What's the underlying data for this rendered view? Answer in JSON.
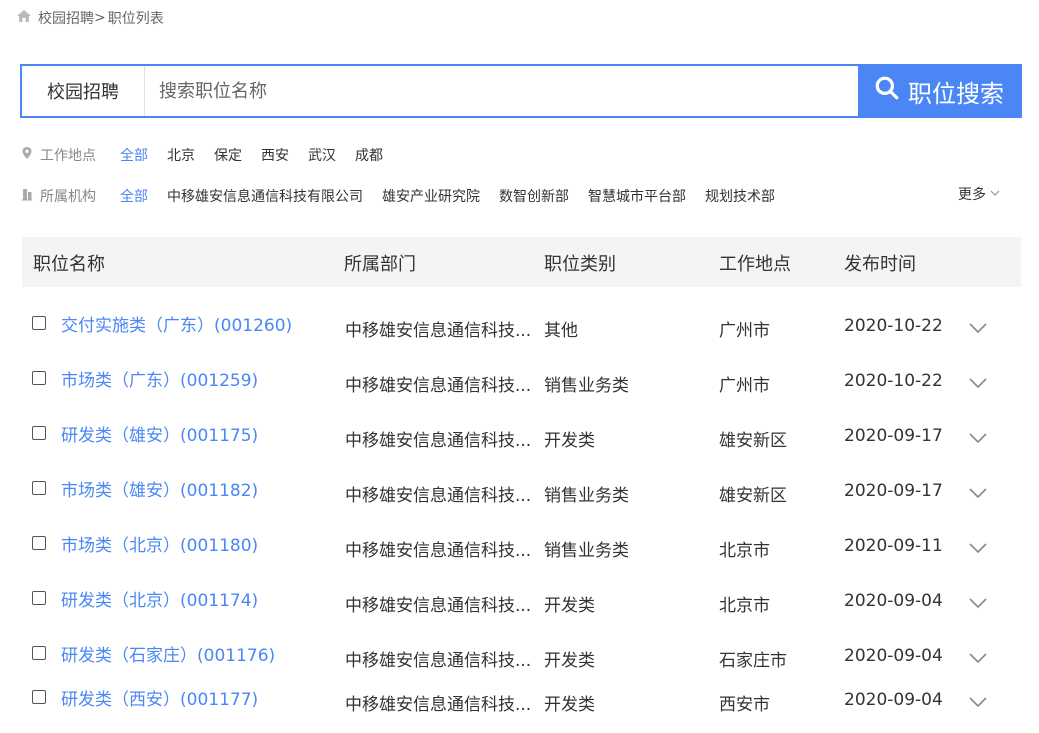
{
  "breadcrumb": {
    "home": "校园招聘",
    "sep": ">",
    "current": "职位列表"
  },
  "search": {
    "category": "校园招聘",
    "placeholder": "搜索职位名称",
    "button_label": "职位搜索"
  },
  "filters": {
    "location": {
      "label": "工作地点",
      "options": [
        "全部",
        "北京",
        "保定",
        "西安",
        "武汉",
        "成都"
      ]
    },
    "org": {
      "label": "所属机构",
      "options": [
        "全部",
        "中移雄安信息通信科技有限公司",
        "雄安产业研究院",
        "数智创新部",
        "智慧城市平台部",
        "规划技术部"
      ],
      "more": "更多"
    }
  },
  "table": {
    "headers": [
      "职位名称",
      "所属部门",
      "职位类别",
      "工作地点",
      "发布时间"
    ],
    "rows": [
      {
        "title": "交付实施类（广东）(001260)",
        "dept": "中移雄安信息通信科技...",
        "cat": "其他",
        "loc": "广州市",
        "date": "2020-10-22"
      },
      {
        "title": "市场类（广东）(001259)",
        "dept": "中移雄安信息通信科技...",
        "cat": "销售业务类",
        "loc": "广州市",
        "date": "2020-10-22"
      },
      {
        "title": "研发类（雄安）(001175)",
        "dept": "中移雄安信息通信科技...",
        "cat": "开发类",
        "loc": "雄安新区",
        "date": "2020-09-17"
      },
      {
        "title": "市场类（雄安）(001182)",
        "dept": "中移雄安信息通信科技...",
        "cat": "销售业务类",
        "loc": "雄安新区",
        "date": "2020-09-17"
      },
      {
        "title": "市场类（北京）(001180)",
        "dept": "中移雄安信息通信科技...",
        "cat": "销售业务类",
        "loc": "北京市",
        "date": "2020-09-11"
      },
      {
        "title": "研发类（北京）(001174)",
        "dept": "中移雄安信息通信科技...",
        "cat": "开发类",
        "loc": "北京市",
        "date": "2020-09-04"
      },
      {
        "title": "研发类（石家庄）(001176)",
        "dept": "中移雄安信息通信科技...",
        "cat": "开发类",
        "loc": "石家庄市",
        "date": "2020-09-04"
      },
      {
        "title": "研发类（西安）(001177)",
        "dept": "中移雄安信息通信科技...",
        "cat": "开发类",
        "loc": "西安市",
        "date": "2020-09-04"
      }
    ]
  },
  "icons": {
    "home": "home-icon",
    "location": "map-pin-icon",
    "org": "building-icon",
    "search": "search-icon",
    "expand": "chevron-down-icon"
  },
  "colors": {
    "accent": "#4a87f5",
    "header_bg": "#f4f4f4"
  }
}
